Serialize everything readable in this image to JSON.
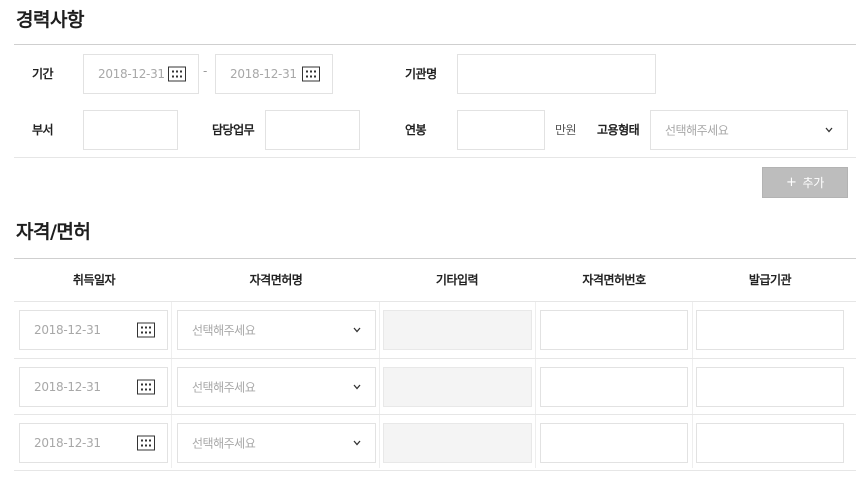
{
  "career": {
    "title": "경력사항",
    "period_label": "기간",
    "period_start": "2018-12-31",
    "period_end": "2018-12-31",
    "period_separator": "-",
    "org_label": "기관명",
    "dept_label": "부서",
    "duty_label": "담당업무",
    "salary_label": "연봉",
    "salary_unit": "만원",
    "employment_label": "고용형태",
    "employment_placeholder": "선택해주세요",
    "add_button": "추가",
    "add_icon": "+"
  },
  "license": {
    "title": "자격/면허",
    "columns": [
      "취득일자",
      "자격면허명",
      "기타입력",
      "자격면허번호",
      "발급기관"
    ],
    "rows": [
      {
        "date": "2018-12-31",
        "name_placeholder": "선택해주세요"
      },
      {
        "date": "2018-12-31",
        "name_placeholder": "선택해주세요"
      },
      {
        "date": "2018-12-31",
        "name_placeholder": "선택해주세요"
      }
    ]
  },
  "icons": {
    "calendar": "calendar-icon",
    "chevron": "chevron-down-icon",
    "add": "plus-icon"
  }
}
